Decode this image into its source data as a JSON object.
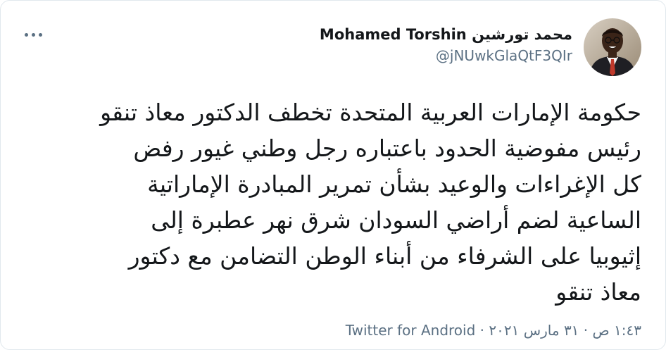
{
  "tweet": {
    "display_name": "محمد تورشين Mohamed Torshin",
    "handle": "@jNUwkGlaQtF3QIr",
    "text": "حكومة الإمارات العربية المتحدة تخطف الدكتور معاذ تنقو\nرئيس مفوضية الحدود باعتباره رجل وطني غيور رفض\nكل الإغراءات والوعيد بشأن تمرير المبادرة الإماراتية\nالساعية لضم أراضي السودان شرق نهر عطبرة إلى\nإثيوبيا على الشرفاء من أبناء الوطن التضامن مع دكتور\nمعاذ تنقو",
    "timestamp": "١:٤٣ ص · ٣١ مارس ٢٠٢١",
    "separator": " · ",
    "source": "Twitter for Android"
  },
  "icons": {
    "more": "more-horizontal-icon",
    "avatar": "profile-photo"
  },
  "colors": {
    "text_primary": "#14171a",
    "text_secondary": "#5b7083",
    "border": "#e1e8ed",
    "background": "#ffffff"
  }
}
